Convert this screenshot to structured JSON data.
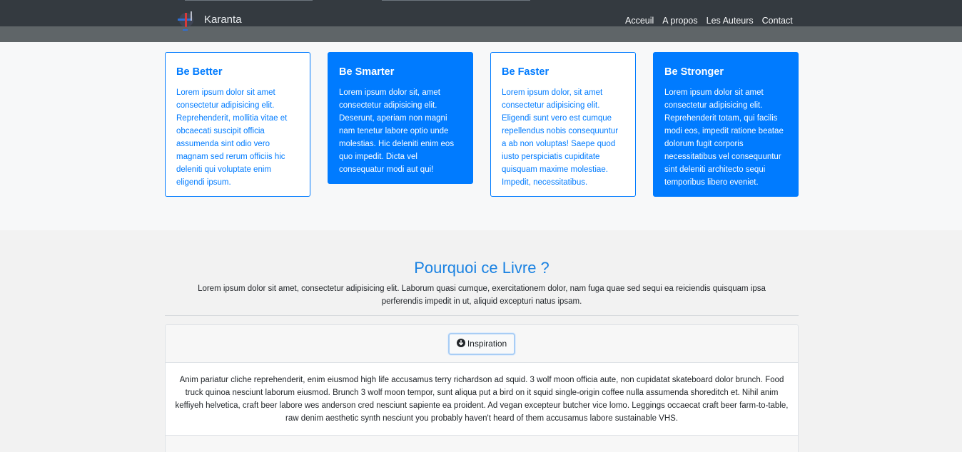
{
  "navbar": {
    "brand": "Karanta",
    "links": [
      "Acceuil",
      "A propos",
      "Les Auteurs",
      "Contact"
    ]
  },
  "features": [
    {
      "title": "Be Better",
      "text": "Lorem ipsum dolor sit amet consectetur adipisicing elit. Reprehenderit, mollitia vitae et obcaecati suscipit officia assumenda sint odio vero magnam sed rerum officiis hic deleniti qui voluptate enim eligendi ipsum.",
      "style": "outline"
    },
    {
      "title": "Be Smarter",
      "text": "Lorem ipsum dolor sit, amet consectetur adipisicing elit. Deserunt, aperiam non magni nam tenetur labore optio unde molestias. Hic deleniti enim eos quo impedit. Dicta vel consequatur modi aut qui!",
      "style": "solid"
    },
    {
      "title": "Be Faster",
      "text": "Lorem ipsum dolor, sit amet consectetur adipisicing elit. Eligendi sunt vero est cumque repellendus nobis consequuntur a ab non voluptas! Saepe quod iusto perspiciatis cupiditate quisquam maxime molestiae. Impedit, necessitatibus.",
      "style": "outline"
    },
    {
      "title": "Be Stronger",
      "text": "Lorem ipsum dolor sit amet consectetur adipisicing elit. Reprehenderit totam, qui facilis modi eos, impedit ratione beatae dolorum fugit corporis necessitatibus vel consequuntur sint deleniti architecto sequi temporibus libero eveniet.",
      "style": "solid"
    }
  ],
  "why": {
    "title": "Pourquoi ce Livre ?",
    "text": "Lorem ipsum dolor sit amet, consectetur adipisicing elit. Laborum quasi cumque, exercitationem dolor, nam fuga quae sed sequi ea reiciendis quisquam ipsa perferendis impedit in ut, aliquid excepturi natus ipsam."
  },
  "accordion": {
    "button_label": "Inspiration",
    "button_icon": "arrow-circle-down-icon",
    "body": "Anim pariatur cliche reprehenderit, enim eiusmod high life accusamus terry richardson ad squid. 3 wolf moon officia aute, non cupidatat skateboard dolor brunch. Food truck quinoa nesciunt laborum eiusmod. Brunch 3 wolf moon tempor, sunt aliqua put a bird on it squid single-origin coffee nulla assumenda shoreditch et. Nihil anim keffiyeh helvetica, craft beer labore wes anderson cred nesciunt sapiente ea proident. Ad vegan excepteur butcher vice lomo. Leggings occaecat craft beer farm-to-table, raw denim aesthetic synth nesciunt you probably haven't heard of them accusamus labore sustainable VHS."
  },
  "colors": {
    "primary": "#007bff",
    "navbar_dark": "#343a40",
    "navbar_band": "#5f6568",
    "heading_blue": "#1a82e2"
  }
}
